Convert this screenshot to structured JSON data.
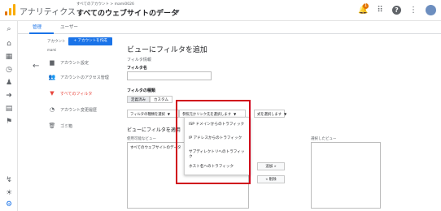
{
  "header": {
    "app_title": "アナリティクス",
    "breadcrumb": "すべてのアカウント > mami0026",
    "property_title": "すべてのウェブサイトのデータ",
    "notification_count": "1",
    "help_label": "?",
    "brand_color": "#f9ab00"
  },
  "tabs": [
    {
      "label": "管理",
      "active": true
    },
    {
      "label": "ユーザー",
      "active": false
    }
  ],
  "account": {
    "label": "アカウント",
    "create_button": "+ アカウントを作成",
    "name": "mami"
  },
  "menu": [
    {
      "icon": "building-icon",
      "label": "アカウント設定",
      "active": false
    },
    {
      "icon": "people-icon",
      "label": "アカウントのアクセス管理",
      "active": false
    },
    {
      "icon": "filter-icon",
      "label": "すべてのフィルタ",
      "active": true
    },
    {
      "icon": "history-icon",
      "label": "アカウント変更履歴",
      "active": false
    },
    {
      "icon": "trash-icon",
      "label": "ゴミ箱",
      "active": false
    }
  ],
  "main": {
    "page_title": "ビューにフィルタを追加",
    "filter_info": "フィルタ情報",
    "filter_name_label": "フィルタ名",
    "filter_name_value": "",
    "filter_type_label": "フィルタの種類",
    "type_options": [
      "定義済み",
      "カスタム"
    ],
    "dropdown_1": "フィルタの種類を選択",
    "dropdown_2": "参照元かリンク先を選択します",
    "dropdown_3": "式を選択します",
    "apply_title": "ビューにフィルタを適用",
    "available_views_label": "使用可能なビュー",
    "selected_views_label": "選択したビュー",
    "available_views": [
      "すべてのウェブサイトのデータ"
    ],
    "add_button": "追加 »",
    "remove_button": "« 削除"
  },
  "popup": {
    "items": [
      "ISP ドメインからのトラフィック",
      "IP アドレスからのトラフィック",
      "サブディレクトリへのトラフィック",
      "ホスト名へのトラフィック"
    ],
    "highlight_color": "#d0021b"
  }
}
